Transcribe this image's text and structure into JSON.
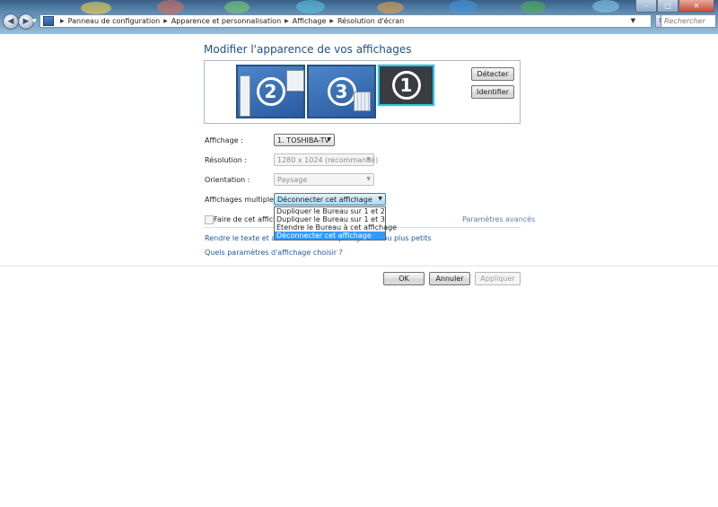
{
  "window": {
    "minimize_glyph": "–",
    "maximize_glyph": "□",
    "close_glyph": "✕"
  },
  "nav": {
    "back_glyph": "◀",
    "forward_glyph": "▶",
    "dropdown_glyph": "▼"
  },
  "address": {
    "separator": "▶",
    "breadcrumbs": [
      "Panneau de configuration",
      "Apparence et personnalisation",
      "Affichage",
      "Résolution d'écran"
    ],
    "dropdown_glyph": "▼",
    "refresh_glyph": "↻"
  },
  "search": {
    "placeholder": "Rechercher"
  },
  "main": {
    "title": "Modifier l'apparence de vos affichages",
    "monitors": [
      {
        "number": "2",
        "style": "blue"
      },
      {
        "number": "3",
        "style": "blue"
      },
      {
        "number": "1",
        "style": "selected-dark"
      }
    ],
    "detect_button": "Détecter",
    "identify_button": "Identifier",
    "fields": {
      "display": {
        "label": "Affichage :",
        "value": "1. TOSHIBA-TV"
      },
      "resolution": {
        "label": "Résolution :",
        "value": "1280 x 1024 (recommandé)"
      },
      "orientation": {
        "label": "Orientation :",
        "value": "Paysage"
      },
      "multiple": {
        "label": "Affichages multiples :",
        "value": "Déconnecter cet affichage"
      }
    },
    "dropdown_options": [
      "Dupliquer le Bureau sur 1 et 2",
      "Dupliquer le Bureau sur 1 et 3",
      "Étendre le Bureau à cet affichage",
      "Déconnecter cet affichage"
    ],
    "dropdown_selected_index": 3,
    "checkbox_label": "Faire de cet affichage",
    "advanced_link": "Paramètres avancés",
    "link_text_size": "Rendre le texte et d'autres éléments plus grands ou plus petits",
    "link_which_settings": "Quels paramètres d'affichage choisir ?"
  },
  "footer": {
    "ok": "OK",
    "cancel": "Annuler",
    "apply": "Appliquer"
  },
  "colors": {
    "link": "#1e5aa0",
    "title": "#1e4f8a",
    "selection": "#3399ff",
    "selected_monitor_border": "#2ec0e3"
  }
}
